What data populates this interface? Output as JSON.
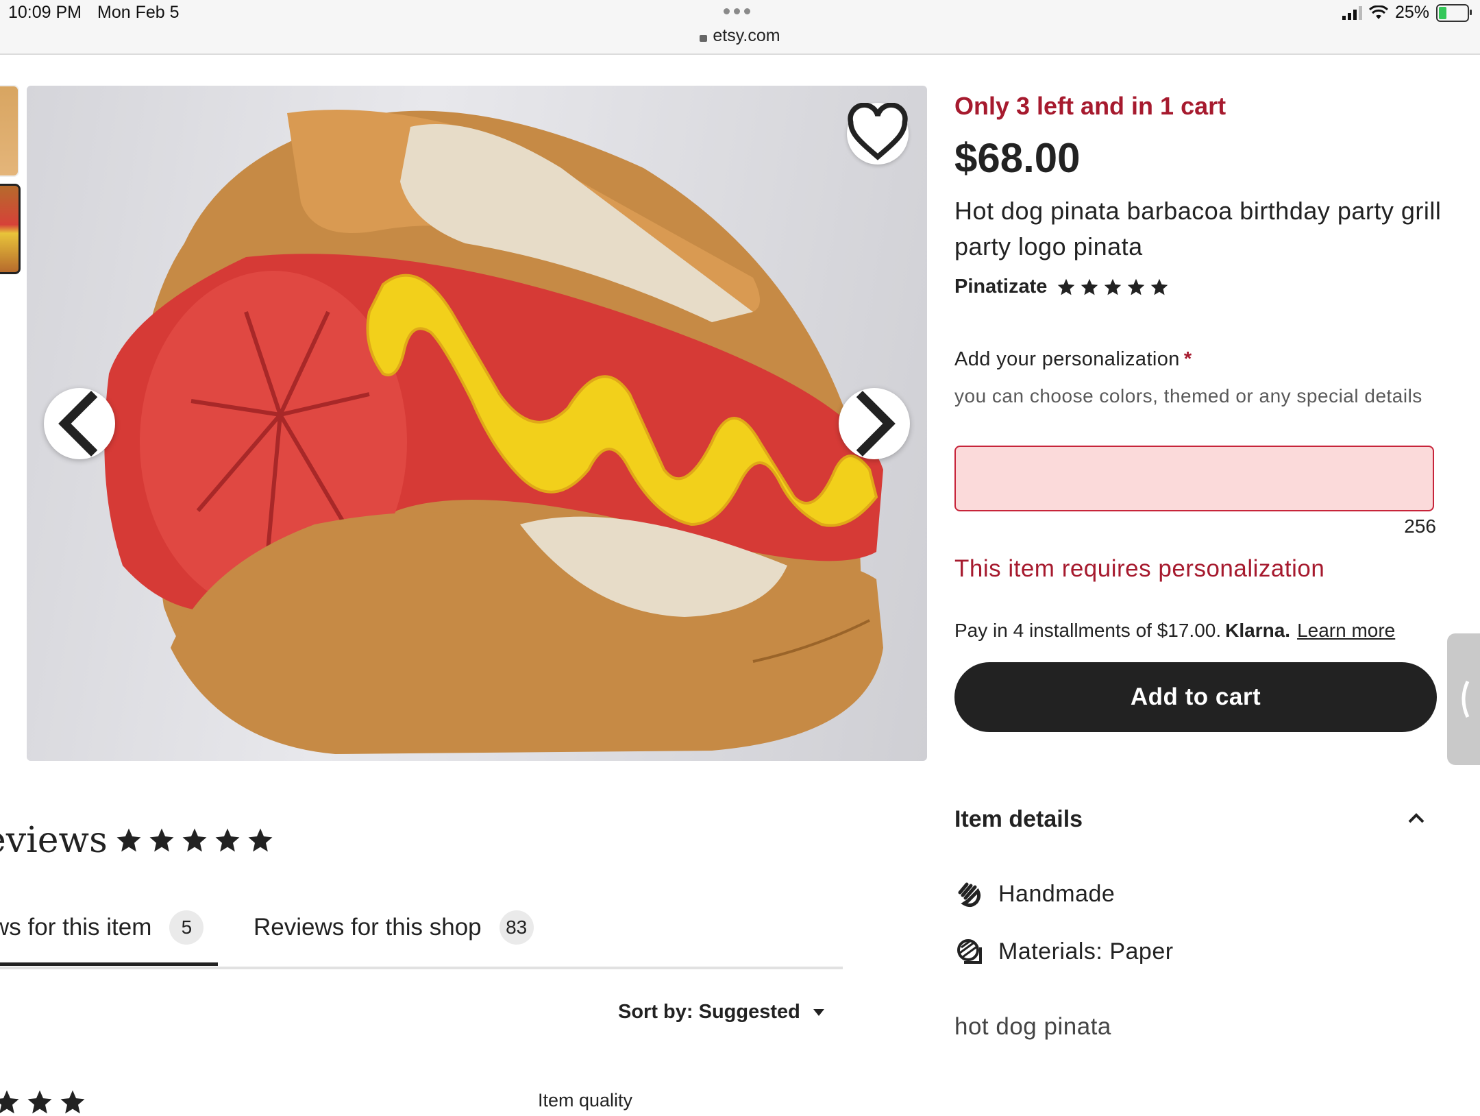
{
  "status_bar": {
    "time": "10:09 PM",
    "date": "Mon Feb 5",
    "url": "etsy.com",
    "battery": "25%"
  },
  "gallery": {
    "favorite_icon": "heart-icon",
    "prev_icon": "chevron-left-icon",
    "next_icon": "chevron-right-icon"
  },
  "listing": {
    "stock_note": "Only 3 left and in 1 cart",
    "price": "$68.00",
    "title": "Hot dog pinata barbacoa birthday party grill party logo pinata",
    "shop_name": "Pinatizate",
    "shop_rating": 5
  },
  "personalization": {
    "label": "Add your personalization",
    "required_mark": "*",
    "help_text": "you can choose colors, themed or any special details",
    "value": "",
    "char_count": "256",
    "error": "This item requires personalization"
  },
  "payment": {
    "installments_text": "Pay in 4 installments of $17.00.",
    "provider": "Klarna.",
    "learn_more": "Learn more"
  },
  "actions": {
    "add_to_cart": "Add to cart"
  },
  "item_details": {
    "header": "Item details",
    "items": [
      {
        "icon": "hand-icon",
        "label": "Handmade"
      },
      {
        "icon": "materials-icon",
        "label": "Materials: Paper"
      }
    ],
    "tag_line": "hot dog pinata"
  },
  "reviews": {
    "title": "eviews",
    "rating": 5,
    "tabs": [
      {
        "label": "ws for this item",
        "count": "5"
      },
      {
        "label": "Reviews for this shop",
        "count": "83"
      }
    ],
    "sort_label": "Sort by: Suggested",
    "item_quality": "Item quality"
  },
  "colors": {
    "accent_red": "#a61a2e",
    "button_dark": "#222222",
    "input_bg": "#fbdada"
  }
}
